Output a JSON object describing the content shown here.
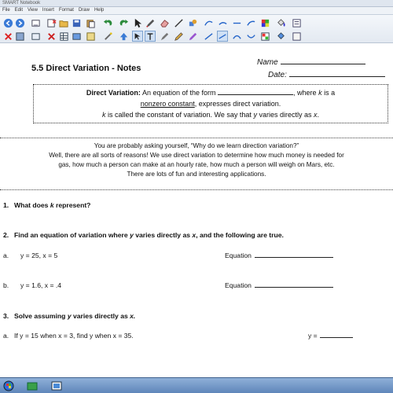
{
  "window": {
    "title": "SMART Notebook"
  },
  "menu": [
    "File",
    "Edit",
    "View",
    "Insert",
    "Format",
    "Draw",
    "Help"
  ],
  "toolbar": {
    "tools_row1": [
      "previous-page",
      "next-page",
      "add-page",
      "delete-page",
      "open",
      "save",
      "paste",
      "undo",
      "redo",
      "cut",
      "screen-shade",
      "full-screen",
      "capture",
      "table"
    ],
    "tools_row2": [
      "select",
      "pen",
      "creative-pen",
      "eraser",
      "line",
      "shapes",
      "magic-pen",
      "fill",
      "text",
      "properties"
    ]
  },
  "doc": {
    "title": "5.5 Direct Variation - Notes",
    "name_label": "Name",
    "date_label": "Date:",
    "definition": {
      "term": "Direct Variation:",
      "text1": "An equation of the form",
      "text2": ", where",
      "k": "k",
      "text3": "is a",
      "underlined": "nonzero constant",
      "text4": ", expresses direct variation.",
      "line2_k": "k",
      "line2a": "is called the constant of variation.  We say that",
      "line2_y": "y",
      "line2b": "varies directly as",
      "line2_x": "x",
      "line2c": "."
    },
    "intro": [
      "You are probably asking yourself, “Why do we learn direction variation?”",
      "Well, there are all sorts of reasons!  We use direct variation to determine how much money is needed for",
      "gas, how much a person can make at an hourly rate, how much a person will weigh on Mars, etc.",
      "There are lots of fun and interesting applications."
    ],
    "q1": {
      "num": "1.",
      "a": "What does",
      "k": "k",
      "b": "represent?"
    },
    "q2": {
      "num": "2.",
      "a": "Find an equation of variation where",
      "y": "y",
      "b": "varies directly as",
      "x": "x",
      "c": ", and the following are true."
    },
    "q2a": {
      "label": "a.",
      "text": "y = 25,  x = 5",
      "eq_label": "Equation"
    },
    "q2b": {
      "label": "b.",
      "text": "y = 1.6,  x = .4",
      "eq_label": "Equation"
    },
    "q3": {
      "num": "3.",
      "a": "Solve assuming",
      "y": "y",
      "b": "varies directly as",
      "x": "x."
    },
    "q3a": {
      "label": "a.",
      "text": "If y = 15 when x = 3, find y when x = 35.",
      "ans_label": "y ="
    }
  }
}
